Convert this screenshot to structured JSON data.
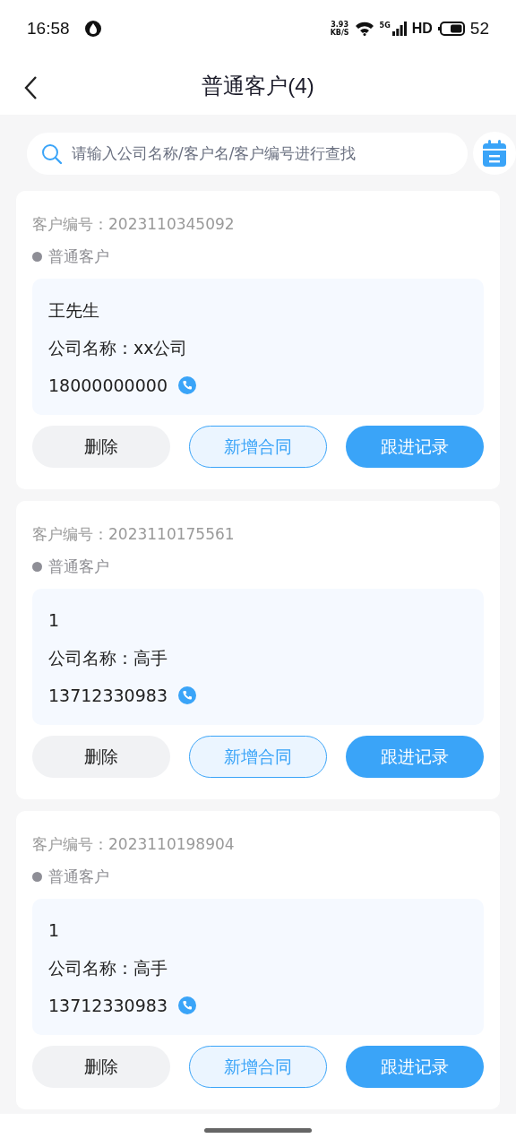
{
  "status_bar": {
    "time": "16:58",
    "speed_value": "3.93",
    "speed_unit": "KB/S",
    "network": "5G",
    "hd": "HD",
    "battery": "52"
  },
  "header": {
    "title": "普通客户(4)"
  },
  "search": {
    "placeholder": "请输入公司名称/客户名/客户编号进行查找"
  },
  "customers": [
    {
      "number_label": "客户编号：",
      "number": "2023110345092",
      "type": "普通客户",
      "name": "王先生",
      "company_label": "公司名称：",
      "company": "xx公司",
      "phone": "18000000000",
      "buttons": {
        "delete": "删除",
        "add_contract": "新增合同",
        "follow_up": "跟进记录"
      }
    },
    {
      "number_label": "客户编号：",
      "number": "2023110175561",
      "type": "普通客户",
      "name": "1",
      "company_label": "公司名称：",
      "company": "高手",
      "phone": "13712330983",
      "buttons": {
        "delete": "删除",
        "add_contract": "新增合同",
        "follow_up": "跟进记录"
      }
    },
    {
      "number_label": "客户编号：",
      "number": "2023110198904",
      "type": "普通客户",
      "name": "1",
      "company_label": "公司名称：",
      "company": "高手",
      "phone": "13712330983",
      "buttons": {
        "delete": "删除",
        "add_contract": "新增合同",
        "follow_up": "跟进记录"
      }
    }
  ]
}
